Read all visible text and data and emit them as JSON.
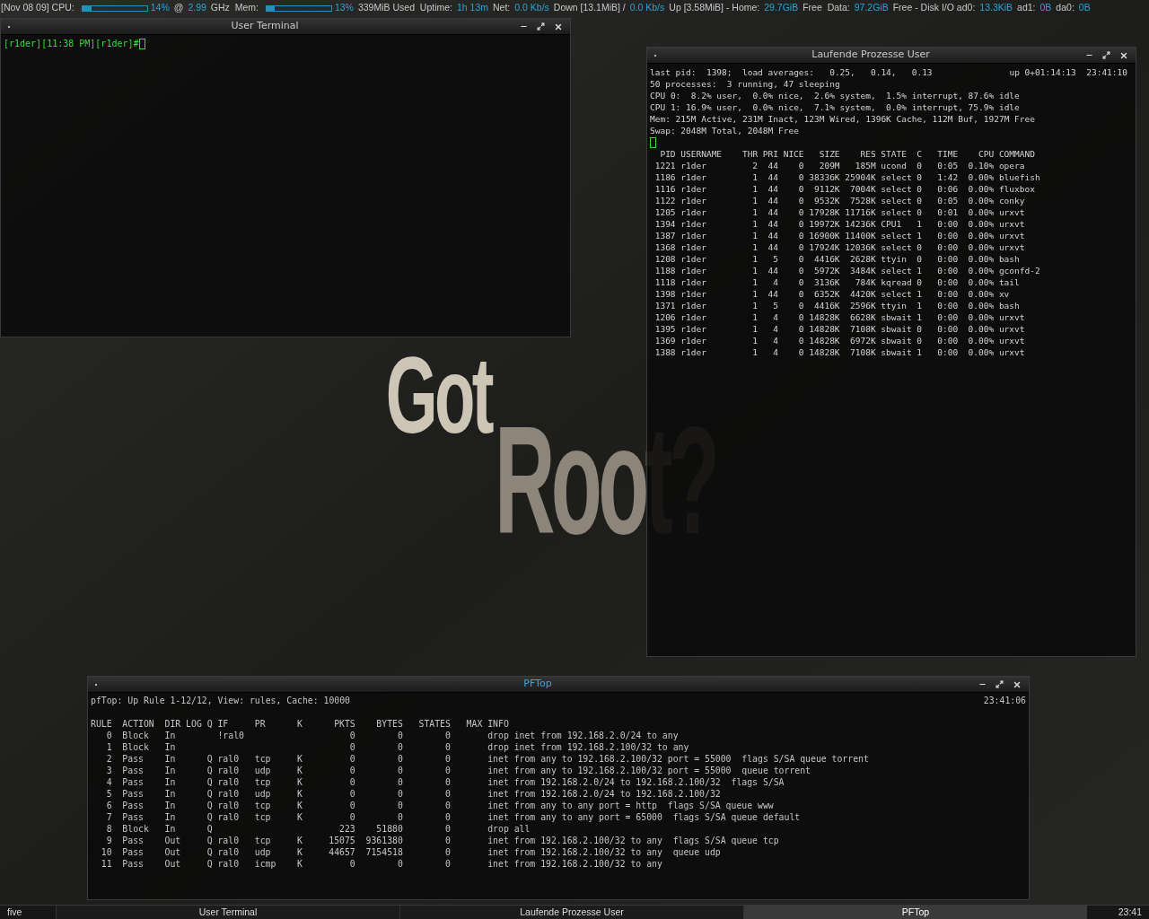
{
  "status_bar": [
    {
      "kind": "text",
      "text": "[Nov 08 09] CPU:"
    },
    {
      "kind": "bar",
      "level": 0.14
    },
    {
      "kind": "value",
      "text": "14%"
    },
    {
      "kind": "text",
      "text": "@"
    },
    {
      "kind": "value",
      "text": "2.99"
    },
    {
      "kind": "text",
      "text": "GHz  Mem:"
    },
    {
      "kind": "bar",
      "level": 0.13
    },
    {
      "kind": "value",
      "text": "13%"
    },
    {
      "kind": "text",
      "text": "339MiB Used  Uptime:"
    },
    {
      "kind": "value",
      "text": "1h 13m"
    },
    {
      "kind": "text",
      "text": "Net:"
    },
    {
      "kind": "value",
      "text": "0.0 Kb/s"
    },
    {
      "kind": "text",
      "text": "Down [13.1MiB] /"
    },
    {
      "kind": "value",
      "text": "0.0 Kb/s"
    },
    {
      "kind": "text",
      "text": "Up [3.58MiB] - Home:"
    },
    {
      "kind": "value",
      "text": "29.7GiB"
    },
    {
      "kind": "text",
      "text": "Free  Data:"
    },
    {
      "kind": "value",
      "text": "97.2GiB"
    },
    {
      "kind": "text",
      "text": "Free - Disk I/O ad0:"
    },
    {
      "kind": "value",
      "text": "13.3KiB"
    },
    {
      "kind": "text",
      "text": "ad1:"
    },
    {
      "kind": "value",
      "text": "0B"
    },
    {
      "kind": "text",
      "text": "da0:"
    },
    {
      "kind": "value",
      "text": "0B"
    }
  ],
  "wallpaper": {
    "line_1": "Got",
    "line_2": "Root?"
  },
  "windows": [
    {
      "kind": "terminal",
      "title": "User Terminal",
      "focused": false,
      "prompt": "[r1der][11:38 PM][r1der]#"
    },
    {
      "kind": "top",
      "title": "Laufende Prozesse User",
      "focused": false,
      "summary": [
        "last pid:  1398;  load averages:   0.25,   0.14,   0.13",
        "50 processes:  3 running, 47 sleeping",
        "CPU 0:  8.2% user,  0.0% nice,  2.6% system,  1.5% interrupt, 87.6% idle",
        "CPU 1: 16.9% user,  0.0% nice,  7.1% system,  0.0% interrupt, 75.9% idle",
        "Mem: 215M Active, 231M Inact, 123M Wired, 1396K Cache, 112M Buf, 1927M Free",
        "Swap: 2048M Total, 2048M Free"
      ],
      "uptime": "up 0+01:14:13  23:41:10",
      "columns": [
        "PID",
        "USERNAME",
        "THR",
        "PRI",
        "NICE",
        "SIZE",
        "RES",
        "STATE",
        "C",
        "TIME",
        "CPU",
        "COMMAND"
      ],
      "rows": [
        [
          "1221",
          "r1der",
          "2",
          "44",
          "0",
          "209M",
          "185M",
          "ucond",
          "0",
          "0:05",
          "0.10%",
          "opera"
        ],
        [
          "1186",
          "r1der",
          "1",
          "44",
          "0",
          "38336K",
          "25904K",
          "select",
          "0",
          "1:42",
          "0.00%",
          "bluefish"
        ],
        [
          "1116",
          "r1der",
          "1",
          "44",
          "0",
          "9112K",
          "7004K",
          "select",
          "0",
          "0:06",
          "0.00%",
          "fluxbox"
        ],
        [
          "1122",
          "r1der",
          "1",
          "44",
          "0",
          "9532K",
          "7528K",
          "select",
          "0",
          "0:05",
          "0.00%",
          "conky"
        ],
        [
          "1205",
          "r1der",
          "1",
          "44",
          "0",
          "17928K",
          "11716K",
          "select",
          "0",
          "0:01",
          "0.00%",
          "urxvt"
        ],
        [
          "1394",
          "r1der",
          "1",
          "44",
          "0",
          "19972K",
          "14236K",
          "CPU1",
          "1",
          "0:00",
          "0.00%",
          "urxvt"
        ],
        [
          "1387",
          "r1der",
          "1",
          "44",
          "0",
          "16900K",
          "11400K",
          "select",
          "1",
          "0:00",
          "0.00%",
          "urxvt"
        ],
        [
          "1368",
          "r1der",
          "1",
          "44",
          "0",
          "17924K",
          "12036K",
          "select",
          "0",
          "0:00",
          "0.00%",
          "urxvt"
        ],
        [
          "1208",
          "r1der",
          "1",
          "5",
          "0",
          "4416K",
          "2628K",
          "ttyin",
          "0",
          "0:00",
          "0.00%",
          "bash"
        ],
        [
          "1188",
          "r1der",
          "1",
          "44",
          "0",
          "5972K",
          "3484K",
          "select",
          "1",
          "0:00",
          "0.00%",
          "gconfd-2"
        ],
        [
          "1118",
          "r1der",
          "1",
          "4",
          "0",
          "3136K",
          "784K",
          "kqread",
          "0",
          "0:00",
          "0.00%",
          "tail"
        ],
        [
          "1398",
          "r1der",
          "1",
          "44",
          "0",
          "6352K",
          "4420K",
          "select",
          "1",
          "0:00",
          "0.00%",
          "xv"
        ],
        [
          "1371",
          "r1der",
          "1",
          "5",
          "0",
          "4416K",
          "2596K",
          "ttyin",
          "1",
          "0:00",
          "0.00%",
          "bash"
        ],
        [
          "1206",
          "r1der",
          "1",
          "4",
          "0",
          "14828K",
          "6628K",
          "sbwait",
          "1",
          "0:00",
          "0.00%",
          "urxvt"
        ],
        [
          "1395",
          "r1der",
          "1",
          "4",
          "0",
          "14828K",
          "7108K",
          "sbwait",
          "0",
          "0:00",
          "0.00%",
          "urxvt"
        ],
        [
          "1369",
          "r1der",
          "1",
          "4",
          "0",
          "14828K",
          "6972K",
          "sbwait",
          "0",
          "0:00",
          "0.00%",
          "urxvt"
        ],
        [
          "1388",
          "r1der",
          "1",
          "4",
          "0",
          "14828K",
          "7108K",
          "sbwait",
          "1",
          "0:00",
          "0.00%",
          "urxvt"
        ]
      ]
    },
    {
      "kind": "pftop",
      "title": "PFTop",
      "focused": true,
      "header": "pfTop: Up Rule 1-12/12, View: rules, Cache: 10000",
      "clock": "23:41:06",
      "columns": [
        "RULE",
        "ACTION",
        "DIR",
        "LOG",
        "Q",
        "IF",
        "PR",
        "K",
        "PKTS",
        "BYTES",
        "STATES",
        "MAX",
        "INFO"
      ],
      "rows": [
        [
          "0",
          "Block",
          "In",
          null,
          null,
          "!ral0",
          null,
          null,
          "0",
          "0",
          "0",
          null,
          "drop inet from 192.168.2.0/24 to any"
        ],
        [
          "1",
          "Block",
          "In",
          null,
          null,
          null,
          null,
          null,
          "0",
          "0",
          "0",
          null,
          "drop inet from 192.168.2.100/32 to any"
        ],
        [
          "2",
          "Pass",
          "In",
          null,
          "Q",
          "ral0",
          "tcp",
          "K",
          "0",
          "0",
          "0",
          null,
          "inet from any to 192.168.2.100/32 port = 55000  flags S/SA queue torrent"
        ],
        [
          "3",
          "Pass",
          "In",
          null,
          "Q",
          "ral0",
          "udp",
          "K",
          "0",
          "0",
          "0",
          null,
          "inet from any to 192.168.2.100/32 port = 55000  queue torrent"
        ],
        [
          "4",
          "Pass",
          "In",
          null,
          "Q",
          "ral0",
          "tcp",
          "K",
          "0",
          "0",
          "0",
          null,
          "inet from 192.168.2.0/24 to 192.168.2.100/32  flags S/SA"
        ],
        [
          "5",
          "Pass",
          "In",
          null,
          "Q",
          "ral0",
          "udp",
          "K",
          "0",
          "0",
          "0",
          null,
          "inet from 192.168.2.0/24 to 192.168.2.100/32"
        ],
        [
          "6",
          "Pass",
          "In",
          null,
          "Q",
          "ral0",
          "tcp",
          "K",
          "0",
          "0",
          "0",
          null,
          "inet from any to any port = http  flags S/SA queue www"
        ],
        [
          "7",
          "Pass",
          "In",
          null,
          "Q",
          "ral0",
          "tcp",
          "K",
          "0",
          "0",
          "0",
          null,
          "inet from any to any port = 65000  flags S/SA queue default"
        ],
        [
          "8",
          "Block",
          "In",
          null,
          "Q",
          null,
          null,
          null,
          "223",
          "51880",
          "0",
          null,
          "drop all"
        ],
        [
          "9",
          "Pass",
          "Out",
          null,
          "Q",
          "ral0",
          "tcp",
          "K",
          "15075",
          "9361380",
          "0",
          null,
          "inet from 192.168.2.100/32 to any  flags S/SA queue tcp"
        ],
        [
          "10",
          "Pass",
          "Out",
          null,
          "Q",
          "ral0",
          "udp",
          "K",
          "44657",
          "7154518",
          "0",
          null,
          "inet from 192.168.2.100/32 to any  queue udp"
        ],
        [
          "11",
          "Pass",
          "Out",
          null,
          "Q",
          "ral0",
          "icmp",
          "K",
          "0",
          "0",
          "0",
          null,
          "inet from 192.168.2.100/32 to any"
        ]
      ]
    }
  ],
  "taskbar": {
    "workspace": "five",
    "tasks": [
      {
        "label": "User Terminal",
        "selected": false
      },
      {
        "label": "Laufende Prozesse User",
        "selected": false
      },
      {
        "label": "PFTop",
        "selected": true
      }
    ],
    "clock": "23:41"
  }
}
